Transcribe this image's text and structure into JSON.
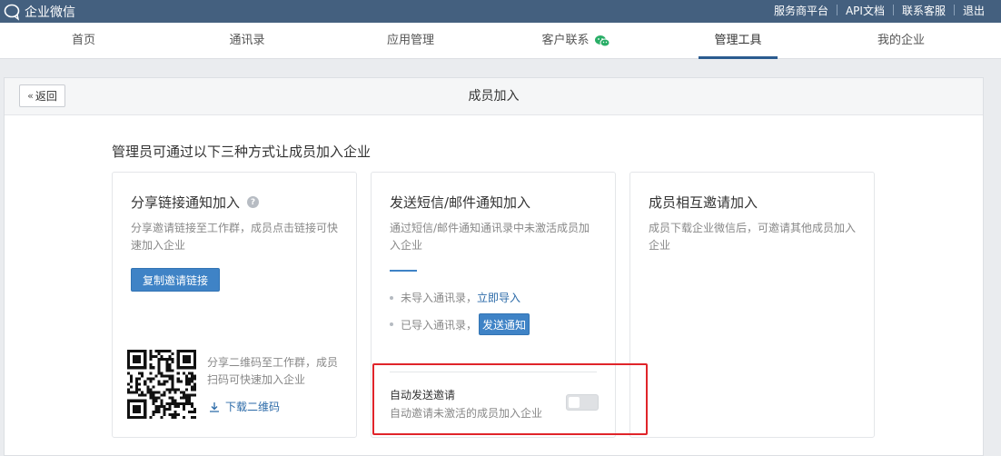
{
  "app": {
    "title": "企业微信"
  },
  "toplinks": [
    "服务商平台",
    "API文档",
    "联系客服",
    "退出"
  ],
  "nav": {
    "items": [
      "首页",
      "通讯录",
      "应用管理",
      "客户联系",
      "管理工具",
      "我的企业"
    ],
    "active": "管理工具"
  },
  "panel": {
    "back_label": "返回",
    "title": "成员加入",
    "intro": "管理员可通过以下三种方式让成员加入企业"
  },
  "cards": {
    "share": {
      "title": "分享链接通知加入",
      "help": "?",
      "desc": "分享邀请链接至工作群，成员点击链接可快速加入企业",
      "button": "复制邀请链接",
      "qr_desc": "分享二维码至工作群，成员扫码可快速加入企业",
      "download": "下载二维码"
    },
    "notify": {
      "title": "发送短信/邮件通知加入",
      "desc": "通过短信/邮件通知通讯录中未激活成员加入企业",
      "bullet1_text": "未导入通讯录，",
      "bullet1_link": "立即导入",
      "bullet2_text": "已导入通讯录，",
      "bullet2_button": "发送通知",
      "auto_title": "自动发送邀请",
      "auto_desc": "自动邀请未激活的成员加入企业",
      "auto_enabled": false
    },
    "mutual": {
      "title": "成员相互邀请加入",
      "desc": "成员下载企业微信后，可邀请其他成员加入企业"
    }
  },
  "colors": {
    "topbar": "#44607f",
    "accent": "#3f83c6",
    "link": "#2b6aa8",
    "highlight": "#e0242a",
    "wechat": "#2aae67"
  }
}
